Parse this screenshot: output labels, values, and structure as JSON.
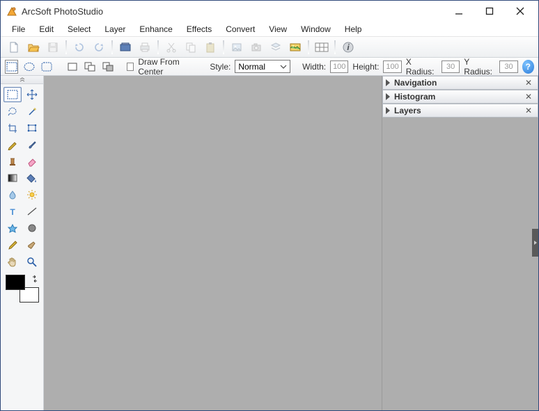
{
  "app": {
    "title": "ArcSoft PhotoStudio"
  },
  "menu": {
    "items": [
      "File",
      "Edit",
      "Select",
      "Layer",
      "Enhance",
      "Effects",
      "Convert",
      "View",
      "Window",
      "Help"
    ]
  },
  "options": {
    "drawFromCenter": "Draw From Center",
    "styleLabel": "Style:",
    "styleValue": "Normal",
    "widthLabel": "Width:",
    "widthValue": "100",
    "heightLabel": "Height:",
    "heightValue": "100",
    "xRadiusLabel": "X Radius:",
    "xRadiusValue": "30",
    "yRadiusLabel": "Y Radius:",
    "yRadiusValue": "30",
    "help": "?"
  },
  "panels": {
    "navigation": "Navigation",
    "histogram": "Histogram",
    "layers": "Layers"
  }
}
